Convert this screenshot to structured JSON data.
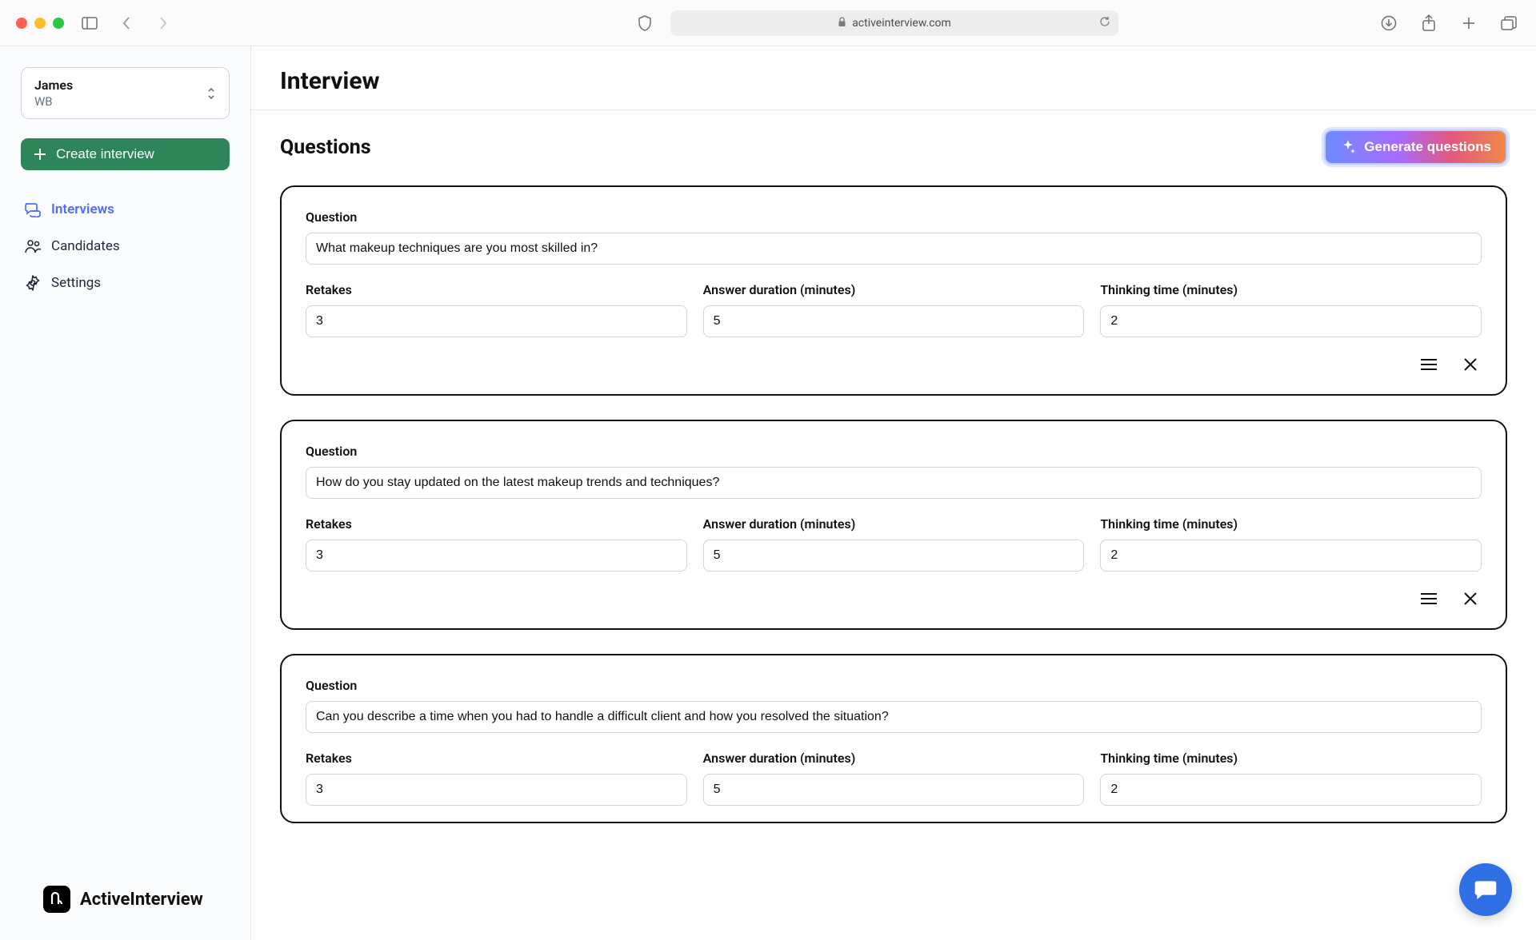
{
  "browser": {
    "url": "activeinterview.com"
  },
  "sidebar": {
    "account": {
      "name": "James",
      "org": "WB"
    },
    "create_label": "Create interview",
    "nav": [
      {
        "label": "Interviews",
        "active": true
      },
      {
        "label": "Candidates",
        "active": false
      },
      {
        "label": "Settings",
        "active": false
      }
    ],
    "brand": "ActiveInterview"
  },
  "page": {
    "title": "Interview",
    "section_title": "Questions",
    "generate_label": "Generate questions",
    "labels": {
      "question": "Question",
      "retakes": "Retakes",
      "answer_duration": "Answer duration (minutes)",
      "thinking_time": "Thinking time (minutes)"
    },
    "questions": [
      {
        "text": "What makeup techniques are you most skilled in?",
        "retakes": "3",
        "answer_duration": "5",
        "thinking_time": "2"
      },
      {
        "text": "How do you stay updated on the latest makeup trends and techniques?",
        "retakes": "3",
        "answer_duration": "5",
        "thinking_time": "2"
      },
      {
        "text": "Can you describe a time when you had to handle a difficult client and how you resolved the situation?",
        "retakes": "3",
        "answer_duration": "5",
        "thinking_time": "2"
      }
    ]
  }
}
